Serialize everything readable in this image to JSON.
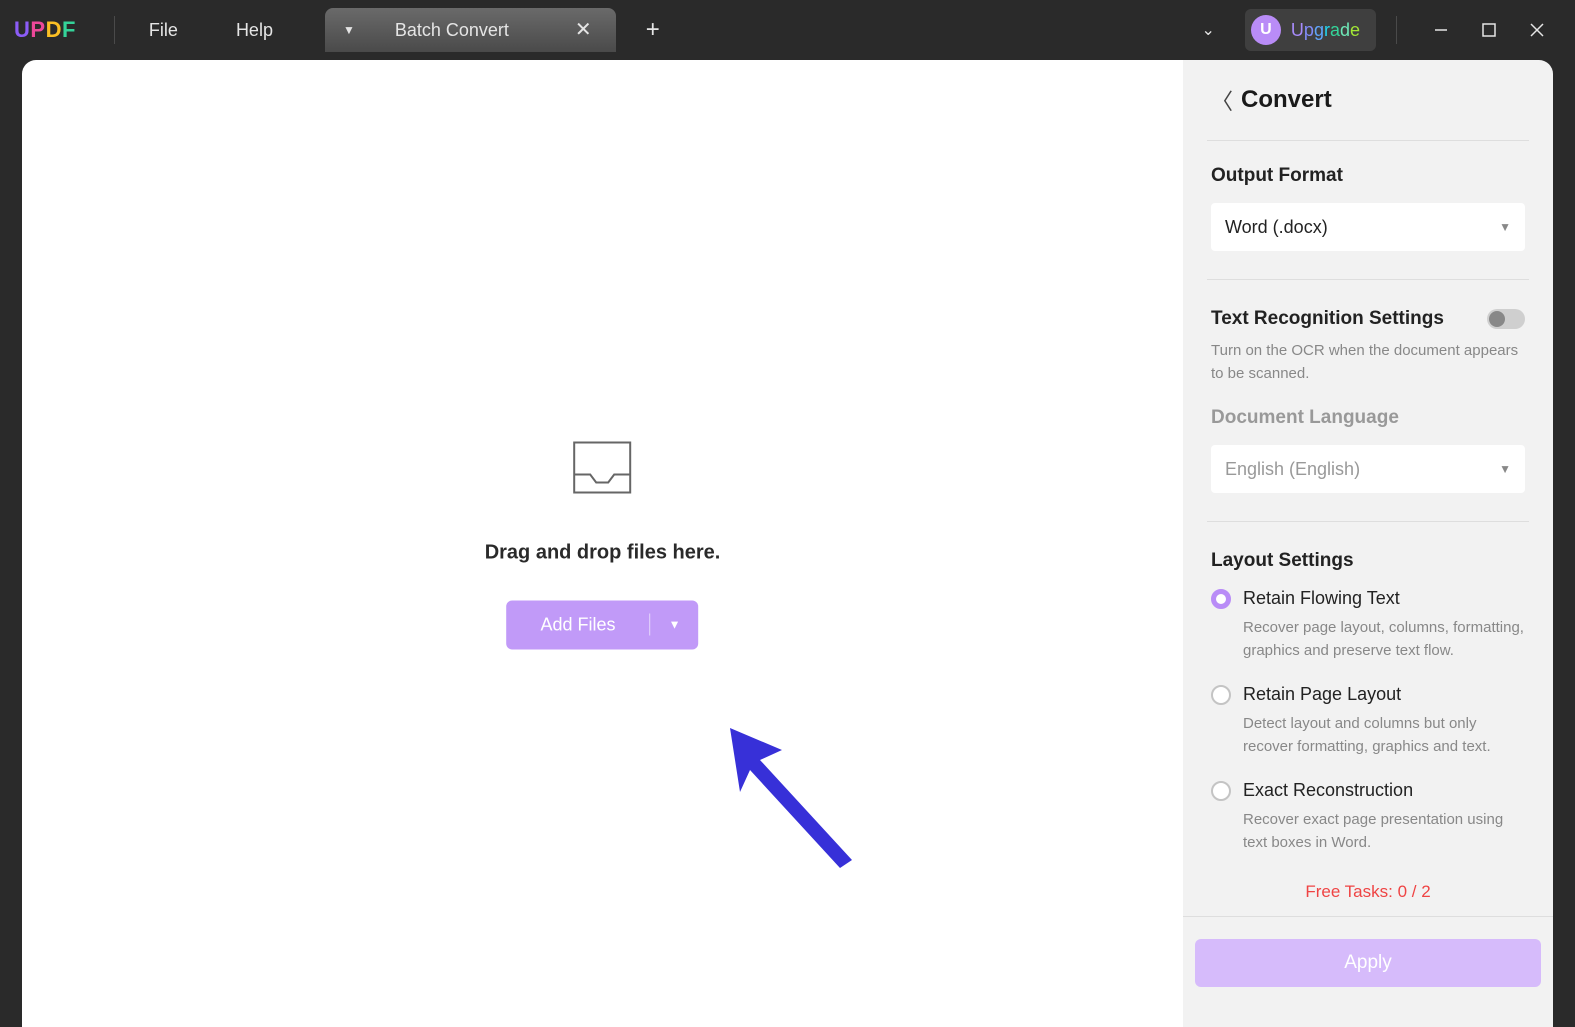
{
  "titlebar": {
    "logo": "UPDF",
    "menu": {
      "file": "File",
      "help": "Help"
    },
    "tab": {
      "label": "Batch Convert"
    },
    "upgrade": {
      "badge": "U",
      "text": "Upgrade"
    }
  },
  "canvas": {
    "drop_text": "Drag and drop files here.",
    "add_files": "Add Files"
  },
  "panel": {
    "title": "Convert",
    "output_format": {
      "label": "Output Format",
      "value": "Word (.docx)"
    },
    "ocr": {
      "label": "Text Recognition Settings",
      "hint": "Turn on the OCR when the document appears to be scanned.",
      "lang_label": "Document Language",
      "lang_value": "English (English)"
    },
    "layout": {
      "label": "Layout Settings",
      "opts": [
        {
          "label": "Retain Flowing Text",
          "desc": "Recover page layout, columns, formatting, graphics and preserve text flow."
        },
        {
          "label": "Retain Page Layout",
          "desc": "Detect layout and columns but only recover formatting, graphics and text."
        },
        {
          "label": "Exact Reconstruction",
          "desc": "Recover exact page presentation using text boxes in Word."
        }
      ]
    },
    "free_tasks": "Free Tasks: 0 / 2",
    "apply": "Apply"
  }
}
